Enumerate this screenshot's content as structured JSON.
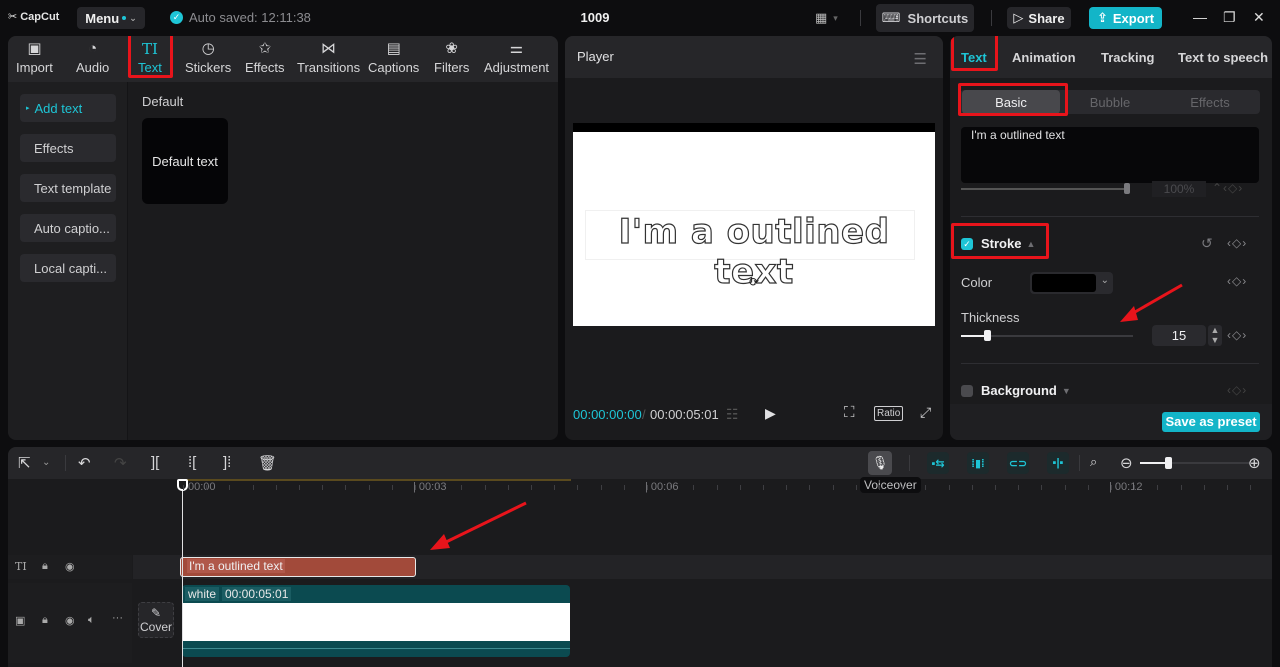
{
  "app": {
    "logo": "CapCut",
    "menu_label": "Menu",
    "autosave": "Auto saved: 12:11:38",
    "project_title": "1009",
    "shortcuts_label": "Shortcuts",
    "share_label": "Share",
    "export_label": "Export"
  },
  "media_toolbar": {
    "tools": [
      {
        "label": "Import",
        "icon": "import-icon"
      },
      {
        "label": "Audio",
        "icon": "audio-icon"
      },
      {
        "label": "Text",
        "icon": "text-icon",
        "active": true
      },
      {
        "label": "Stickers",
        "icon": "stickers-icon"
      },
      {
        "label": "Effects",
        "icon": "effects-icon"
      },
      {
        "label": "Transitions",
        "icon": "transitions-icon"
      },
      {
        "label": "Captions",
        "icon": "captions-icon"
      },
      {
        "label": "Filters",
        "icon": "filters-icon"
      },
      {
        "label": "Adjustment",
        "icon": "adjustment-icon"
      }
    ]
  },
  "text_sidebar": {
    "items": [
      {
        "label": "Add text",
        "active": true
      },
      {
        "label": "Effects"
      },
      {
        "label": "Text template"
      },
      {
        "label": "Auto captio..."
      },
      {
        "label": "Local capti..."
      }
    ],
    "section_label": "Default",
    "card_label": "Default text"
  },
  "player": {
    "title": "Player",
    "canvas_text": "I'm a outlined text",
    "current_time": "00:00:00:00",
    "separator": "/",
    "total_time": "00:00:05:01",
    "ratio_label": "Ratio"
  },
  "inspector": {
    "tabs": [
      "Text",
      "Animation",
      "Tracking",
      "Text to speech"
    ],
    "active_tab": "Text",
    "subtabs": [
      "Basic",
      "Bubble",
      "Effects"
    ],
    "active_subtab": "Basic",
    "text_value": "I'm a outlined text",
    "opacity_value": "100%",
    "opacity_fraction": 1.0,
    "stroke": {
      "title": "Stroke",
      "enabled": true,
      "color_label": "Color",
      "color_value": "#000000",
      "thickness_label": "Thickness",
      "thickness_value": "15",
      "thickness_fraction": 0.15
    },
    "background": {
      "title": "Background",
      "enabled": false
    },
    "save_preset_label": "Save as preset"
  },
  "timeline": {
    "tooltip": "Voiceover",
    "ruler_labels": [
      "00:00",
      "00:03",
      "00:06",
      "00:12"
    ],
    "zoom_fraction": 0.25,
    "text_clip_label": "I'm a outlined text",
    "video_clip_name": "white",
    "video_clip_duration": "00:00:05:01",
    "cover_label": "Cover"
  },
  "colors": {
    "accent": "#1ec5d6",
    "export_bg": "#13b5c8",
    "text_clip": "#a24a3a",
    "video_clip": "#0b4a50",
    "annotation_red": "#e8141b"
  }
}
